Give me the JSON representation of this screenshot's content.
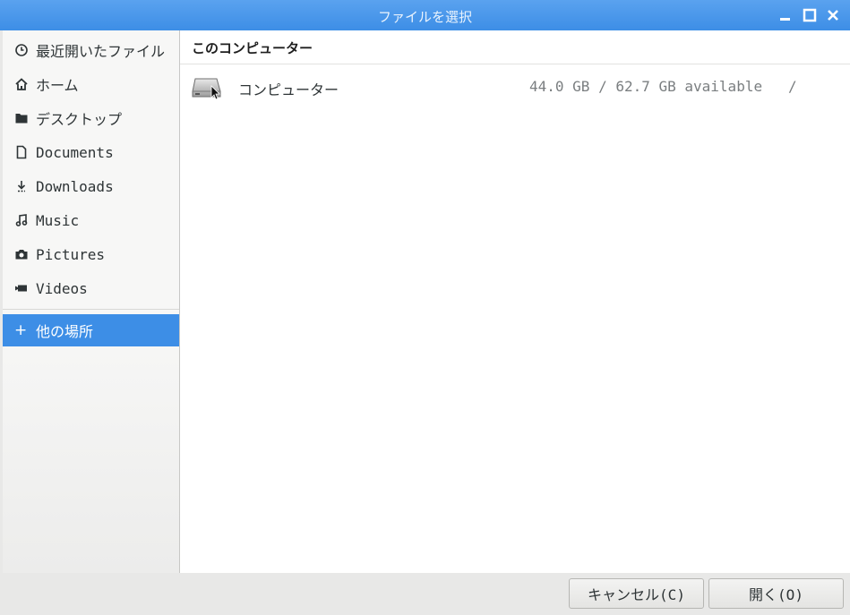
{
  "window": {
    "title": "ファイルを選択"
  },
  "sidebar": {
    "items": [
      {
        "label": "最近開いたファイル",
        "icon": "clock-icon"
      },
      {
        "label": "ホーム",
        "icon": "home-icon"
      },
      {
        "label": "デスクトップ",
        "icon": "folder-icon"
      },
      {
        "label": "Documents",
        "icon": "document-icon"
      },
      {
        "label": "Downloads",
        "icon": "download-icon"
      },
      {
        "label": "Music",
        "icon": "music-icon"
      },
      {
        "label": "Pictures",
        "icon": "camera-icon"
      },
      {
        "label": "Videos",
        "icon": "video-icon"
      }
    ],
    "other": {
      "label": "他の場所",
      "icon_glyph": "+"
    }
  },
  "main": {
    "section_title": "このコンピューター",
    "locations": [
      {
        "name": "コンピューター",
        "space": "44.0 GB / 62.7 GB available",
        "mount": "/",
        "icon": "hard-drive-icon"
      }
    ]
  },
  "buttons": {
    "cancel": "キャンセル(C)",
    "open": "開く(O)"
  },
  "colors": {
    "accent": "#3d8ee6",
    "titlebar": "#4a97ea"
  }
}
